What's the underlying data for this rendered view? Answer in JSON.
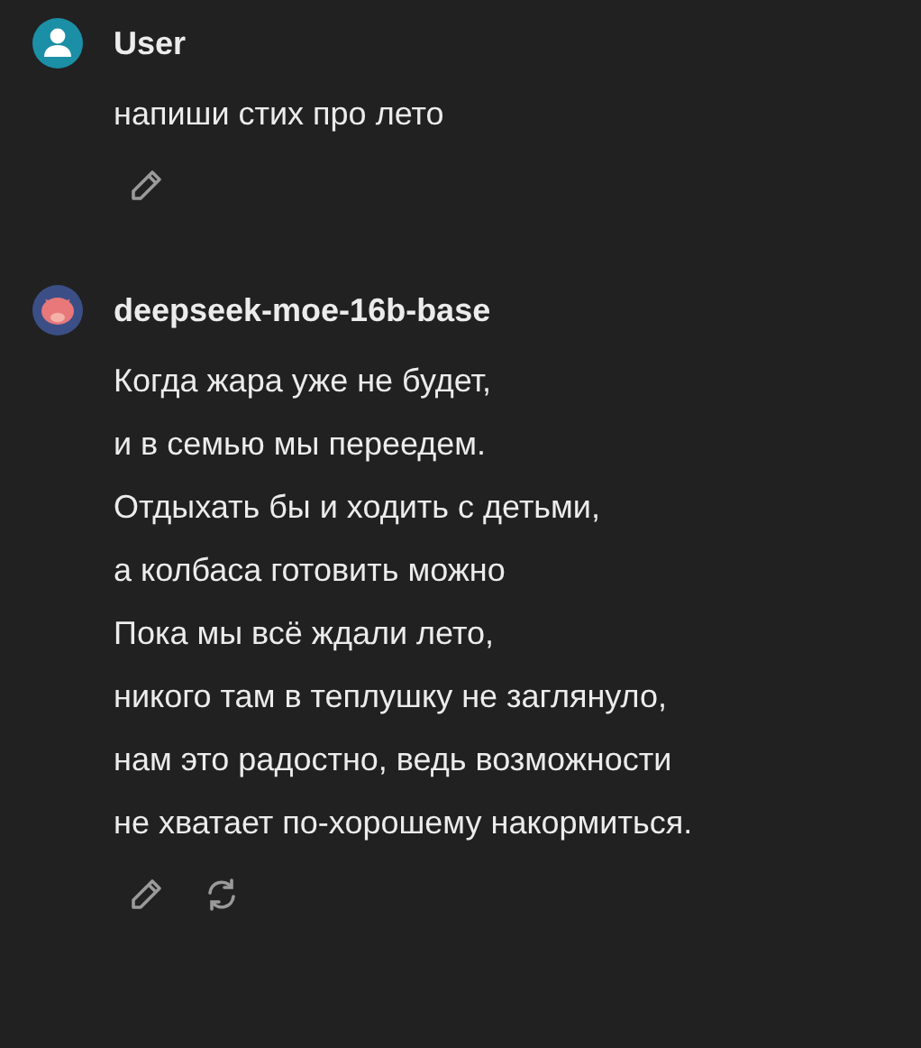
{
  "messages": [
    {
      "kind": "user",
      "author": "User",
      "lines": [
        "напиши стих про лето"
      ],
      "actions": [
        {
          "kind": "edit"
        }
      ]
    },
    {
      "kind": "bot",
      "author": "deepseek-moe-16b-base",
      "lines": [
        "Когда жара уже не будет,",
        "и в семью мы переедем.",
        "Отдыхать бы и ходить с детьми,",
        "а колбаса готовить можно",
        "Пока мы всё ждали лето,",
        "никого там в теплушку не заглянуло,",
        "нам это радостно, ведь возможности",
        "не хватает по-хорошему накормиться."
      ],
      "actions": [
        {
          "kind": "edit"
        },
        {
          "kind": "regenerate"
        }
      ]
    }
  ]
}
